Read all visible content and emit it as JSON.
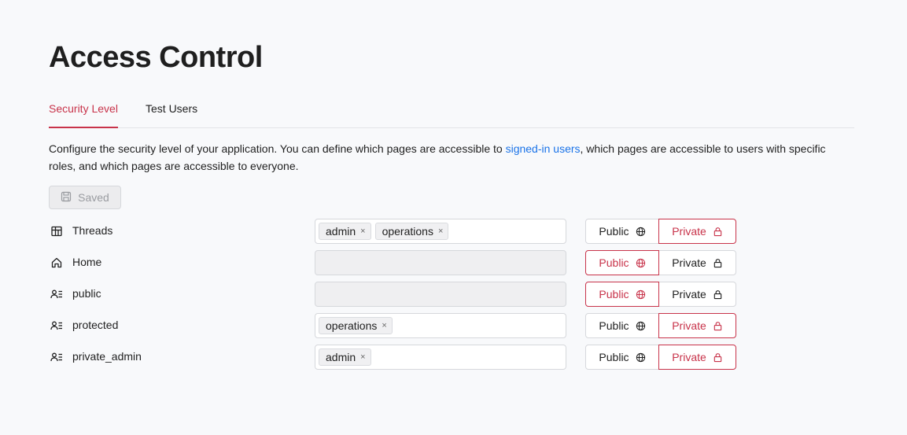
{
  "page": {
    "title": "Access Control",
    "tabs": [
      "Security Level",
      "Test Users"
    ],
    "description": {
      "before": "Configure the security level of your application. You can define which pages are accessible to ",
      "link": "signed-in users",
      "after": ", which pages are accessible to users with specific roles, and which pages are accessible to everyone."
    },
    "saved_label": "Saved"
  },
  "toggle_labels": {
    "public": "Public",
    "private": "Private"
  },
  "remove_glyph": "×",
  "rows": [
    {
      "label": "Threads",
      "icon": "board-icon",
      "roles": [
        "admin",
        "operations"
      ],
      "selected": "private"
    },
    {
      "label": "Home",
      "icon": "home-icon",
      "roles": [],
      "selected": "public"
    },
    {
      "label": "public",
      "icon": "users-list-icon",
      "roles": [],
      "selected": "public"
    },
    {
      "label": "protected",
      "icon": "users-list-icon",
      "roles": [
        "operations"
      ],
      "selected": "private"
    },
    {
      "label": "private_admin",
      "icon": "users-list-icon",
      "roles": [
        "admin"
      ],
      "selected": "private"
    }
  ],
  "colors": {
    "accent": "#c8334a",
    "link": "#1a73e8",
    "background": "#f8f9fb"
  }
}
